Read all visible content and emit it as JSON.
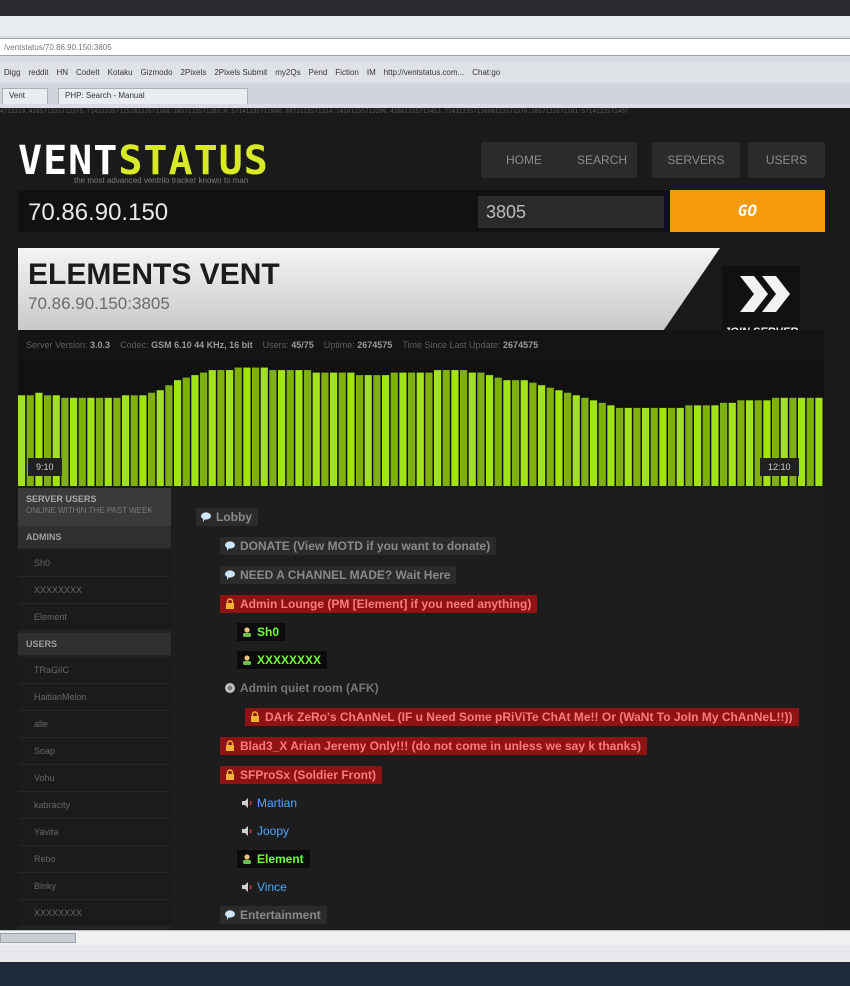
{
  "browser": {
    "address": "/ventstatus/70.86.90.150:3805",
    "bookmarks": [
      "Digg",
      "reddit",
      "HN",
      "CodeIt",
      "Kotaku",
      "Gizmodo",
      "2Pixels",
      "2Pixels Submit",
      "my2Qs",
      "Pend",
      "Fiction",
      "IM",
      "http://ventstatus.com...",
      "Chat:go"
    ],
    "tabs": [
      "Vent",
      "PHP: Search - Manual"
    ],
    "digits": "4712219.428571235712375.71431235712528123571268:2857123571285:0.57141235712990.8971123571314:14291235713299.42861235713453.71431235713608123571376:2857123571391:5714123571407"
  },
  "site": {
    "logo_a": "VENT",
    "logo_b": "STATUS",
    "tagline": "the most advanced ventrilo tracker known to man",
    "nav": [
      "HOME",
      "SEARCH",
      "SERVERS",
      "USERS"
    ]
  },
  "search": {
    "ip": "70.86.90.150",
    "port": "3805",
    "go": "GO"
  },
  "server": {
    "name": "ELEMENTS VENT",
    "address": "70.86.90.150:3805",
    "join": "JOIN SERVER"
  },
  "stats": {
    "version_label": "Server Version:",
    "version": "3.0.3",
    "codec_label": "Codec:",
    "codec": "GSM 6.10 44 KHz, 16 bit",
    "users_label": "Users:",
    "users": "45/75",
    "uptime_label": "Uptime:",
    "uptime": "2674575",
    "update_label": "Time Since Last Update:",
    "update": "2674575"
  },
  "graph": {
    "start_time": "9:10",
    "end_time": "12:10",
    "bar_color": "#a2e21a",
    "bar_color_alt": "#7fb010",
    "levels": [
      0.72,
      0.72,
      0.74,
      0.72,
      0.72,
      0.7,
      0.7,
      0.7,
      0.7,
      0.7,
      0.7,
      0.7,
      0.72,
      0.72,
      0.72,
      0.74,
      0.76,
      0.8,
      0.84,
      0.86,
      0.88,
      0.9,
      0.92,
      0.92,
      0.92,
      0.94,
      0.94,
      0.94,
      0.94,
      0.92,
      0.92,
      0.92,
      0.92,
      0.92,
      0.9,
      0.9,
      0.9,
      0.9,
      0.9,
      0.88,
      0.88,
      0.88,
      0.88,
      0.9,
      0.9,
      0.9,
      0.9,
      0.9,
      0.92,
      0.92,
      0.92,
      0.92,
      0.9,
      0.9,
      0.88,
      0.86,
      0.84,
      0.84,
      0.84,
      0.82,
      0.8,
      0.78,
      0.76,
      0.74,
      0.72,
      0.7,
      0.68,
      0.66,
      0.64,
      0.62,
      0.62,
      0.62,
      0.62,
      0.62,
      0.62,
      0.62,
      0.62,
      0.64,
      0.64,
      0.64,
      0.64,
      0.66,
      0.66,
      0.68,
      0.68,
      0.68,
      0.68,
      0.7,
      0.7,
      0.7,
      0.7,
      0.7,
      0.7
    ]
  },
  "sidebar": {
    "title": "SERVER USERS",
    "subtitle": "ONLINE WITHIN THE PAST WEEK",
    "admins_label": "ADMINS",
    "admins": [
      "Sh0",
      "XXXXXXXX",
      "Element"
    ],
    "users_label": "USERS",
    "users": [
      "TRaGiIC",
      "HaitianMelon",
      "alle",
      "Soap",
      "Vohu",
      "kabracity",
      "Yavita",
      "Rebo",
      "Binky",
      "XXXXXXXX"
    ]
  },
  "channels": {
    "lobby": "Lobby",
    "donate": "DONATE (View MOTD if you want to donate)",
    "need": "NEED A CHANNEL MADE? Wait Here",
    "admin_lounge": "Admin Lounge (PM [Element] if you need anything)",
    "admin_quiet": "Admin quiet room (AFK)",
    "dark_zero": "DArk ZeRo's ChAnNeL (IF u Need Some pRiViTe ChAt Me!! Or (WaNt To JoIn My ChAnNeL!!))",
    "blad3": "Blad3_X Arian Jeremy Only!!! (do not come in unless we say k thanks)",
    "sfprosx": "SFProSx (Soldier Front)",
    "entertainment": "Entertainment"
  },
  "users_in_channels": {
    "sh0": "Sh0",
    "xxx": "XXXXXXXX",
    "martian": "Martian",
    "joopy": "Joopy",
    "element": "Element",
    "vince": "Vince"
  }
}
